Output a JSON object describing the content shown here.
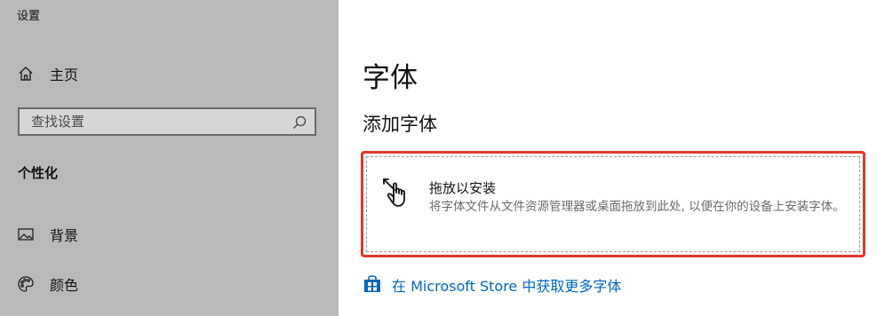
{
  "sidebar": {
    "app_title": "设置",
    "home_label": "主页",
    "search_placeholder": "查找设置",
    "section_label": "个性化",
    "items": [
      {
        "label": "背景",
        "icon": "picture-icon"
      },
      {
        "label": "颜色",
        "icon": "palette-icon"
      }
    ]
  },
  "main": {
    "title": "字体",
    "subtitle": "添加字体",
    "drop": {
      "title": "拖放以安装",
      "description": "将字体文件从文件资源管理器或桌面拖放到此处, 以便在你的设备上安装字体。"
    },
    "store_link": "在 Microsoft Store 中获取更多字体"
  },
  "colors": {
    "accent": "#0067c0",
    "highlight": "#e0372f",
    "sidebar_bg": "#b9b9b9"
  }
}
